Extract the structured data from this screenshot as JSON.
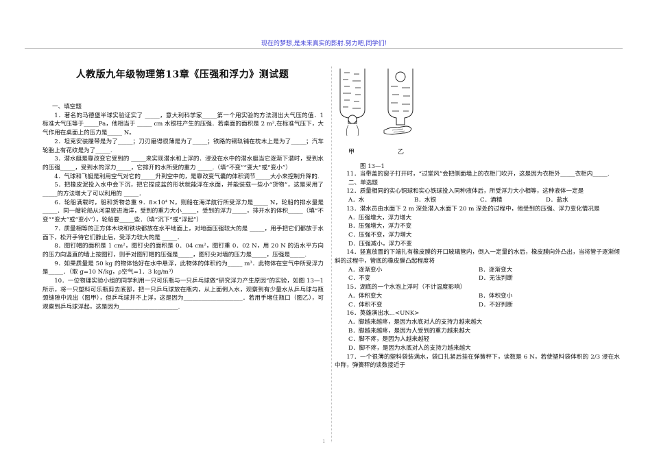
{
  "header": {
    "motto": "现在的梦想,是未来真实的影射.努力吧,同学们!"
  },
  "title": "人教版九年级物理第13章《压强和浮力》测试题",
  "figure": {
    "label_a": "甲",
    "label_b": "乙",
    "caption": "图 13—1"
  },
  "left_col": [
    "一、填空题",
    "1．著名的马德堡半球实验证实了 _____，意大利科学家_____第一个用实验的方法测出大气压的值．1 标准大气压等于_____Pa，他相当于 _____ cm 水银柱产生的压强．若桌面的面积是 2 m²,在标准气压下，大气作用在桌面上的压力是_____ N。",
    "2．坦克安装履带是为了_____；刀刃磨得很薄是为了_____；铁路的钢轨铺在枕木上是为了_____；汽车轮胎上有花纹是为了_____.",
    "3．潜水艇是靠改变它受到的 _____来实现潜水和上浮的．浸没在水中的潜水艇当它逐渐下潜时，受到水的压强_____，受到水的浮力_____，它排开的水所受的重力 _____.（填“不变”“变大”或“变小”）",
    "4．气球和飞艇是利用空气对它的_____升到空中的，是靠改变气囊的体积调节_____大小来控制升降的.",
    "5．把橡皮泥投入水中会下沉，把它捏成盆的形状就能浮在水面，并能装载一些小“货物”，这是采用了_____的方法增大了可以利用的 _____．",
    "6．轮船满载时，船和货物总重 9．8×10⁴ N，则船在海洋航行所受浮力是_____ N，轮船的排水量是_____．同一艘轮船从河里驶进海洋，受到的重力大小_____，受到的浮力_____，排开水的体积_____（填“不变”“变大”或“变小”），轮船要_____些．（填“沉下”或“浮起”）",
    "7．质量相等的正方体木块和铁块都放在水平地面上，对地面压强较大的是 _____，用手把它们都放于水面下，松开手待它们静止后，受浮力较大的是 _____．",
    "8．图钉帽的面积是 1 cm²，图钉尖的面积是 0．04 cm²，图钉重 0．02 N，用 20 N 的沿水平方向的压力向竖直的墙上按图钉，则手对图钉帽的压强是_____，图钉尖对墙的压力是_____，压强是_____.",
    "9．如果质量是 50 kg 的物体恰好在水中悬浮，此物体的体积约为_____ m³．此物体在空气中所受浮力是_____．（取 g=10 N/kg，ρ空气=1．3 kg/m³）",
    "10．一位物理实验小组的同学利用一只可乐瓶与一只乒乓球做“研究浮力产生原因”的实验，如图 13—1 所示，将一只塑料可乐瓶剪去底部，把一只乒乓球放在瓶内，从上面倒入水，观察到有少量水从乒乓球与瓶颈缝隙中流出（图甲），但乒乓球并不上浮，这是因为____________________．若用手堵住瓶口（图乙），可观察到乒乓球浮起，这是因为____________________."
  ],
  "right_col": [
    "11．当带盖的窗子打开时，“过堂风”会把侧面墙上的衣柜门吹开，这是因为衣柜外_____衣柜内_____.",
    "二、单选题",
    "12．质量相同的实心铜球和实心铁球投入同种液体后，所受浮力大小相等，这种液体一定是",
    [
      "A．水",
      "B．水银",
      "C．酒精",
      "D．盐水"
    ],
    "13．潜水员由水面下 2 m 深处潜入水面下 20 m 深处的过程中，他受到的压强、浮力变化情况是",
    "A．压强增大，浮力增大",
    "B．压强增大，浮力不变",
    "C．压强不变，浮力增大",
    "D．压强减小，浮力不变",
    "14．竖直放置的下端扎有橡皮膜的开口玻璃管内，倒入一定量的水后，橡皮膜向外凸出，当将管子逐渐倾斜的过程中，管底的橡皮膜凸起程度将",
    [
      "A．逐渐变小",
      "B．逐渐变大"
    ],
    [
      "C．不变",
      "D．无法判断"
    ],
    "15．湖底的一个水泡上浮时（不计温度影响）",
    [
      "A．体积变大",
      "B．体积变小"
    ],
    [
      "C．体积不变",
      "D．不好判断"
    ],
    "16．英雄演出水...<UNK>",
    "A．脚越来越疼，是因为水底对人的支持力越来越大",
    "B．脚越来越疼，是因为人受到的重力越来越大",
    "C．脚不疼，是因为人越来越轻",
    "D．脚不疼，是因为水底对人的支持力越来越大",
    "17．一个很薄的塑料袋装满水，袋口扎紧后挂在弹簧秤下，读数是 6 N，若使塑料袋体积的 2/3 浸在水中称，弹簧秤的读数接近于"
  ],
  "page_number": "1"
}
